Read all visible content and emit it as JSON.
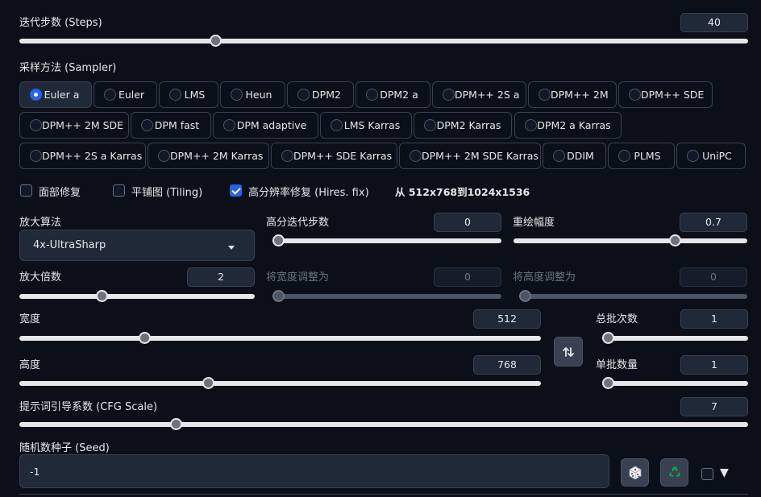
{
  "steps": {
    "label": "迭代步数 (Steps)",
    "value": "40",
    "fraction": 0.265
  },
  "sampler": {
    "label": "采样方法 (Sampler)",
    "options": [
      "Euler a",
      "Euler",
      "LMS",
      "Heun",
      "DPM2",
      "DPM2 a",
      "DPM++ 2S a",
      "DPM++ 2M",
      "DPM++ SDE",
      "DPM++ 2M SDE",
      "DPM fast",
      "DPM adaptive",
      "LMS Karras",
      "DPM2 Karras",
      "DPM2 a Karras",
      "DPM++ 2S a Karras",
      "DPM++ 2M Karras",
      "DPM++ SDE Karras",
      "DPM++ 2M SDE Karras",
      "DDIM",
      "PLMS",
      "UniPC"
    ],
    "selected": "Euler a"
  },
  "checkboxes": {
    "face_restore": {
      "label": "面部修复",
      "checked": false
    },
    "tiling": {
      "label": "平铺图 (Tiling)",
      "checked": false
    },
    "hires_fix": {
      "label": "高分辨率修复 (Hires. fix)",
      "checked": true
    },
    "hires_info": "从 512x768到1024x1536"
  },
  "hires": {
    "upscaler_label": "放大算法",
    "upscaler_value": "4x-UltraSharp",
    "hires_steps": {
      "label": "高分迭代步数",
      "value": "0",
      "fraction": 0.0
    },
    "denoise": {
      "label": "重绘幅度",
      "value": "0.7",
      "fraction": 0.7
    },
    "upscale_by": {
      "label": "放大倍数",
      "value": "2",
      "fraction": 0.34
    },
    "resize_width": {
      "label": "将宽度调整为",
      "value": "0",
      "fraction": 0.0
    },
    "resize_height": {
      "label": "将高度调整为",
      "value": "0",
      "fraction": 0.0
    }
  },
  "size": {
    "width": {
      "label": "宽度",
      "value": "512",
      "fraction": 0.234
    },
    "height": {
      "label": "高度",
      "value": "768",
      "fraction": 0.359
    },
    "swap_icon": "swap-vertical-icon"
  },
  "batch": {
    "count": {
      "label": "总批次数",
      "value": "1",
      "fraction": 0.0
    },
    "size": {
      "label": "单批数量",
      "value": "1",
      "fraction": 0.0
    }
  },
  "cfg": {
    "label": "提示词引导系数 (CFG Scale)",
    "value": "7",
    "fraction": 0.21
  },
  "seed": {
    "label": "随机数种子 (Seed)",
    "value": "-1",
    "dice_icon": "dice-icon",
    "recycle_icon": "recycle-icon",
    "extra_label": "▼"
  },
  "colors": {
    "accent": "#2563eb",
    "bg": "#0b0f19",
    "panel": "#1f2937"
  }
}
